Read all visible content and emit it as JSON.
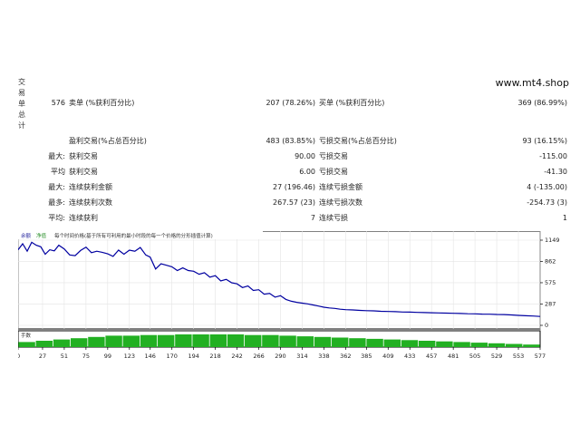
{
  "report": {
    "section_label": [
      "交",
      "易",
      "单",
      "总",
      "计"
    ],
    "site": "www.mt4.shop",
    "rows": [
      {
        "c0": "576",
        "c1": "卖单 (%获利百分比)",
        "c2": "207 (78.26%)",
        "c3": "买单 (%获利百分比)",
        "c4": "369 (86.99%)"
      },
      {
        "c0": "",
        "c1": "盈利交易(%占总百分比)",
        "c2": "483 (83.85%)",
        "c3": "亏损交易(%占总百分比)",
        "c4": "93 (16.15%)"
      },
      {
        "c0": "最大:",
        "c1": "获利交易",
        "c2": "90.00",
        "c3": "亏损交易",
        "c4": "-115.00"
      },
      {
        "c0": "平均",
        "c1": "获利交易",
        "c2": "6.00",
        "c3": "亏损交易",
        "c4": "-41.30"
      },
      {
        "c0": "最大:",
        "c1": "连续获利金额",
        "c2": "27 (196.46)",
        "c3": "连续亏损金额",
        "c4": "4 (-135.00)"
      },
      {
        "c0": "最多:",
        "c1": "连续获利次数",
        "c2": "267.57 (23)",
        "c3": "连续亏损次数",
        "c4": "-254.73 (3)"
      },
      {
        "c0": "平均:",
        "c1": "连续获利",
        "c2": "7",
        "c3": "连续亏损",
        "c4": "1"
      }
    ]
  },
  "chart_data": {
    "type": "line",
    "legend": [
      "余额",
      "净值",
      "每个时间价格(基于所有可利用的最小时段的每一个价格的分形插值计算)"
    ],
    "volume_label": "手数",
    "y_ticks": [
      1149,
      862,
      575,
      287,
      0
    ],
    "ylim": [
      0,
      1149
    ],
    "x_ticks": [
      0,
      27,
      51,
      75,
      99,
      123,
      146,
      170,
      194,
      218,
      242,
      266,
      290,
      314,
      338,
      362,
      385,
      409,
      433,
      457,
      481,
      505,
      529,
      553,
      577
    ],
    "xlim": [
      0,
      577
    ],
    "series": [
      {
        "x": [
          0,
          5,
          10,
          15,
          20,
          25,
          30,
          35,
          40,
          45,
          51,
          57,
          63,
          69,
          75,
          81,
          87,
          93,
          99,
          105,
          111,
          117,
          123,
          129,
          135,
          141,
          146,
          152,
          158,
          164,
          170,
          176,
          182,
          188,
          194,
          200,
          206,
          212,
          218,
          224,
          230,
          236,
          242,
          248,
          254,
          260,
          266,
          272,
          278,
          284,
          290,
          296,
          302,
          308,
          314,
          320,
          326,
          332,
          338,
          344,
          350,
          356,
          362,
          370,
          378,
          385,
          393,
          401,
          409,
          417,
          425,
          433,
          441,
          449,
          457,
          465,
          473,
          481,
          489,
          497,
          505,
          513,
          521,
          529,
          537,
          545,
          553,
          561,
          569,
          577
        ],
        "y": [
          1020,
          1100,
          1000,
          1120,
          1080,
          1060,
          960,
          1020,
          1005,
          1080,
          1030,
          950,
          940,
          1010,
          1055,
          980,
          1000,
          985,
          965,
          930,
          1015,
          960,
          1015,
          1000,
          1050,
          950,
          920,
          760,
          830,
          810,
          790,
          740,
          775,
          740,
          730,
          690,
          710,
          650,
          670,
          600,
          620,
          575,
          560,
          510,
          530,
          470,
          480,
          420,
          430,
          380,
          400,
          350,
          325,
          310,
          300,
          290,
          275,
          260,
          245,
          235,
          228,
          218,
          212,
          208,
          202,
          198,
          195,
          190,
          187,
          184,
          180,
          178,
          175,
          172,
          170,
          168,
          165,
          162,
          160,
          157,
          155,
          152,
          150,
          147,
          145,
          140,
          135,
          130,
          126,
          120
        ]
      }
    ],
    "volume": [
      8,
      10,
      12,
      14,
      16,
      18,
      18,
      19,
      19,
      20,
      20,
      20,
      20,
      19,
      19,
      18,
      17,
      16,
      15,
      14,
      13,
      12,
      11,
      10,
      9,
      8,
      7,
      6,
      5,
      4
    ]
  }
}
